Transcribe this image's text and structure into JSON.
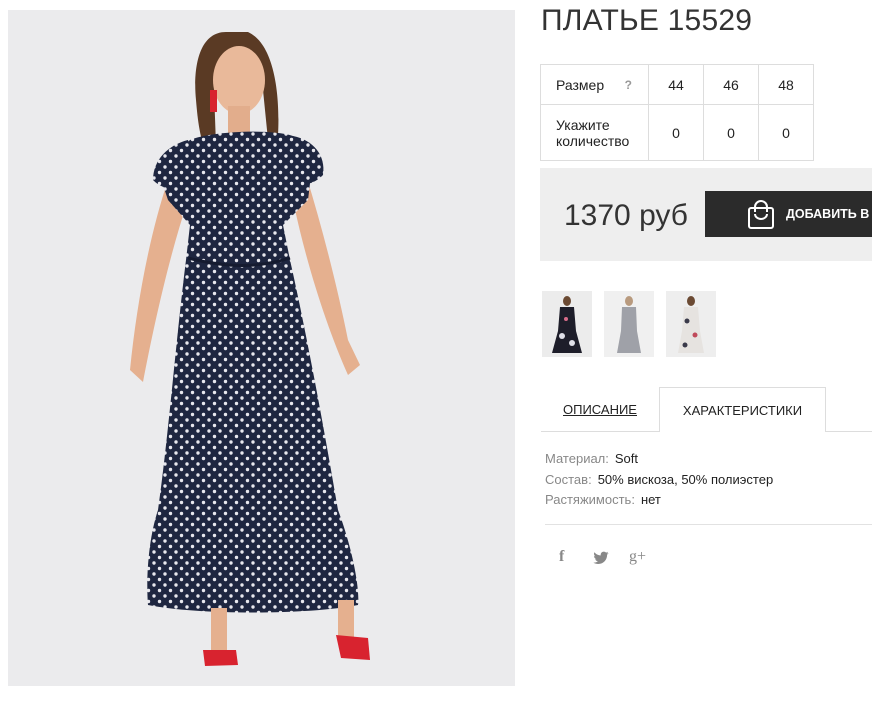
{
  "product": {
    "title": "ПЛАТЬЕ 15529",
    "price": "1370 руб",
    "add_to_cart": "ДОБАВИТЬ В З"
  },
  "size_table": {
    "size_label": "Размер",
    "help_mark": "?",
    "sizes": [
      "44",
      "46",
      "48"
    ],
    "qty_label_line1": "Укажите",
    "qty_label_line2": "количество",
    "quantities": [
      "0",
      "0",
      "0"
    ]
  },
  "tabs": {
    "description": "ОПИСАНИЕ",
    "characteristics": "ХАРАКТЕРИСТИКИ",
    "active": "characteristics"
  },
  "specs": [
    {
      "key": "Материал:",
      "value": "Soft"
    },
    {
      "key": "Состав:",
      "value": "50% вискоза, 50% полиэстер"
    },
    {
      "key": "Растяжимость:",
      "value": "нет"
    }
  ],
  "social": {
    "facebook": "f",
    "twitter_icon": "twitter-bird-icon",
    "google_plus": "g+"
  },
  "colors": {
    "dress_navy": "#1e2640",
    "shoe_red": "#d8232f",
    "button_dark": "#2b2b2b",
    "price_bg": "#eeeeee"
  }
}
